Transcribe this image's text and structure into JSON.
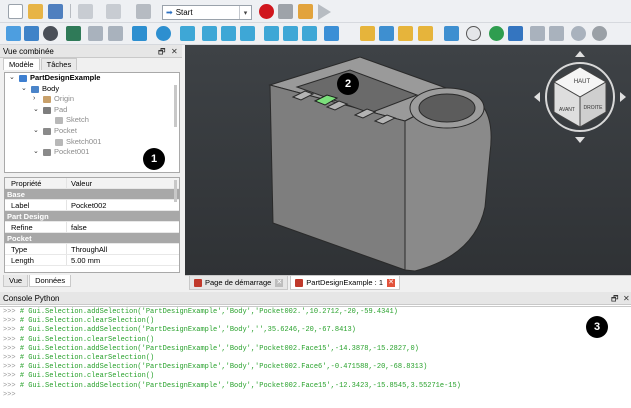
{
  "toolbar": {
    "workbench": "Start",
    "icons_row1": [
      "new-icon",
      "open-icon",
      "save-icon",
      "undo-icon",
      "redo-icon",
      "refresh-icon",
      "record-macro-icon",
      "stop-macro-icon",
      "edit-macro-icon",
      "run-macro-icon"
    ],
    "icons_row2": [
      "fit-all-icon",
      "fit-selection-icon",
      "draw-style-icon",
      "std-view-icon",
      "back-icon",
      "forward-icon",
      "sync-view-icon",
      "zoom-icon",
      "view-isometric-icon",
      "view-front-icon",
      "view-top-icon",
      "view-right-icon",
      "view-rear-icon",
      "view-bottom-icon",
      "view-left-icon",
      "measure-icon",
      "part-icon",
      "group-icon",
      "link-icon",
      "link-actions-icon",
      "whats-this-icon",
      "toggle-clip-icon",
      "web-home-icon",
      "web-back-icon",
      "web-forward-icon",
      "web-refresh-icon",
      "web-stop-icon"
    ]
  },
  "combo_view": {
    "title": "Vue combinée",
    "tabs": [
      "Modèle",
      "Tâches"
    ],
    "tree": [
      {
        "label": "PartDesignExample",
        "level": 0,
        "expanded": true,
        "bold": true,
        "grey": false,
        "icon": "document-icon"
      },
      {
        "label": "Body",
        "level": 1,
        "expanded": true,
        "bold": false,
        "grey": false,
        "icon": "body-icon"
      },
      {
        "label": "Origin",
        "level": 2,
        "expanded": false,
        "bold": false,
        "grey": true,
        "icon": "origin-icon"
      },
      {
        "label": "Pad",
        "level": 2,
        "expanded": true,
        "bold": false,
        "grey": true,
        "icon": "pad-icon"
      },
      {
        "label": "Sketch",
        "level": 3,
        "expanded": null,
        "bold": false,
        "grey": true,
        "icon": "sketch-icon"
      },
      {
        "label": "Pocket",
        "level": 2,
        "expanded": true,
        "bold": false,
        "grey": true,
        "icon": "pocket-icon"
      },
      {
        "label": "Sketch001",
        "level": 3,
        "expanded": null,
        "bold": false,
        "grey": true,
        "icon": "sketch-icon"
      },
      {
        "label": "Pocket001",
        "level": 2,
        "expanded": true,
        "bold": false,
        "grey": true,
        "icon": "pocket-icon"
      }
    ],
    "properties_header": {
      "name": "Propriété",
      "value": "Valeur"
    },
    "properties": [
      {
        "type": "group",
        "name": "Base"
      },
      {
        "type": "prop",
        "name": "Label",
        "value": "Pocket002"
      },
      {
        "type": "group",
        "name": "Part Design"
      },
      {
        "type": "prop",
        "name": "Refine",
        "value": "false"
      },
      {
        "type": "group",
        "name": "Pocket"
      },
      {
        "type": "prop",
        "name": "Type",
        "value": "ThroughAll"
      },
      {
        "type": "prop",
        "name": "Length",
        "value": "5.00 mm"
      }
    ],
    "bottom_tabs": [
      "Vue",
      "Données"
    ]
  },
  "nav_cube": {
    "top": "HAUT",
    "front": "AVANT",
    "right": "DROITE"
  },
  "document_tabs": [
    {
      "label": "Page de démarrage",
      "active": false
    },
    {
      "label": "PartDesignExample : 1",
      "active": true
    }
  ],
  "console": {
    "title": "Console Python",
    "prompt": ">>> ",
    "lines": [
      "# Gui.Selection.addSelection('PartDesignExample','Body','Pocket002.',10.2712,-20,-59.4341)",
      "# Gui.Selection.clearSelection()",
      "# Gui.Selection.addSelection('PartDesignExample','Body','',35.6246,-20,-67.8413)",
      "# Gui.Selection.clearSelection()",
      "# Gui.Selection.addSelection('PartDesignExample','Body','Pocket002.Face15',-14.3878,-15.2827,0)",
      "# Gui.Selection.clearSelection()",
      "# Gui.Selection.addSelection('PartDesignExample','Body','Pocket002.Face6',-0.471588,-20,-68.8313)",
      "# Gui.Selection.clearSelection()",
      "# Gui.Selection.addSelection('PartDesignExample','Body','Pocket002.Face15',-12.3423,-15.8545,3.55271e-15)",
      ""
    ]
  },
  "badges": [
    "1",
    "2",
    "3"
  ],
  "colors": {
    "viewport_bg": "#3a3d40",
    "console_text": "#27a12b",
    "selected_face": "#7ce07c",
    "group_row": "#a8a8a8"
  }
}
